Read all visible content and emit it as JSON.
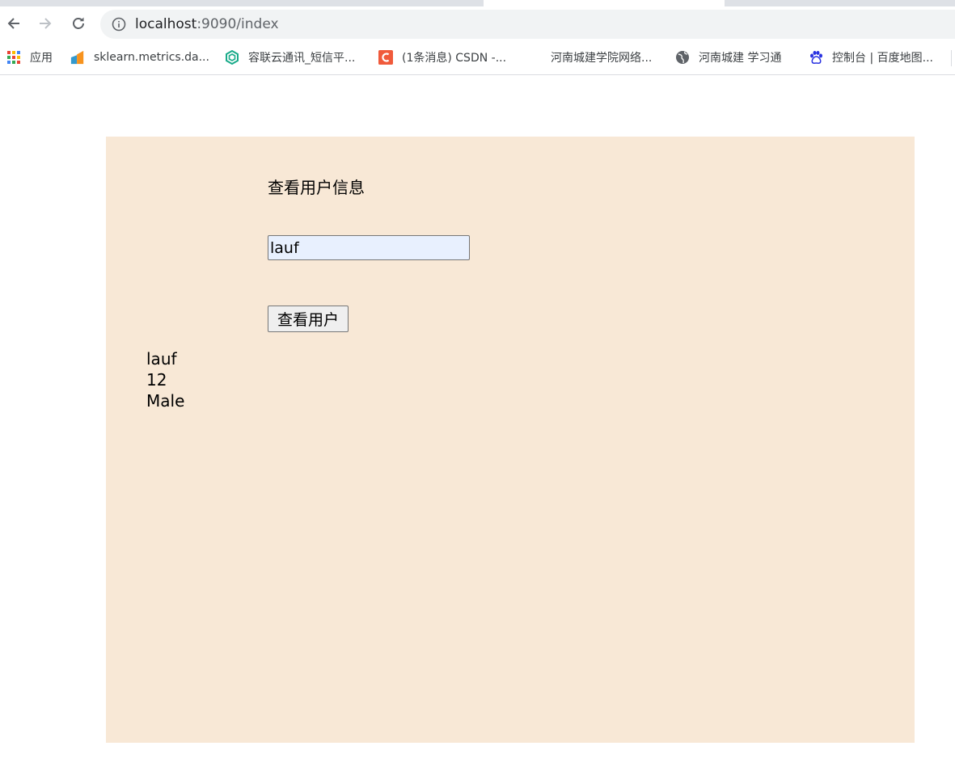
{
  "browser": {
    "url_host": "localhost",
    "url_path": ":9090/index"
  },
  "bookmarks": [
    {
      "label": "应用",
      "icon": "apps-grid-icon"
    },
    {
      "label": "sklearn.metrics.da...",
      "icon": "sklearn-icon"
    },
    {
      "label": "容联云通讯_短信平...",
      "icon": "hexagon-icon"
    },
    {
      "label": "(1条消息) CSDN -...",
      "icon": "csdn-icon"
    },
    {
      "label": "河南城建学院网络...",
      "icon": "blank-icon"
    },
    {
      "label": "河南城建  学习通",
      "icon": "globe-icon"
    },
    {
      "label": "控制台 | 百度地图...",
      "icon": "baidu-paw-icon"
    }
  ],
  "page": {
    "title": "查看用户信息",
    "input_value": "lauf",
    "button_label": "查看用户",
    "result": {
      "name": "lauf",
      "age": "12",
      "gender": "Male"
    }
  },
  "colors": {
    "panel_bg": "#f8e8d6",
    "input_autofill_bg": "#e8f0fe"
  }
}
